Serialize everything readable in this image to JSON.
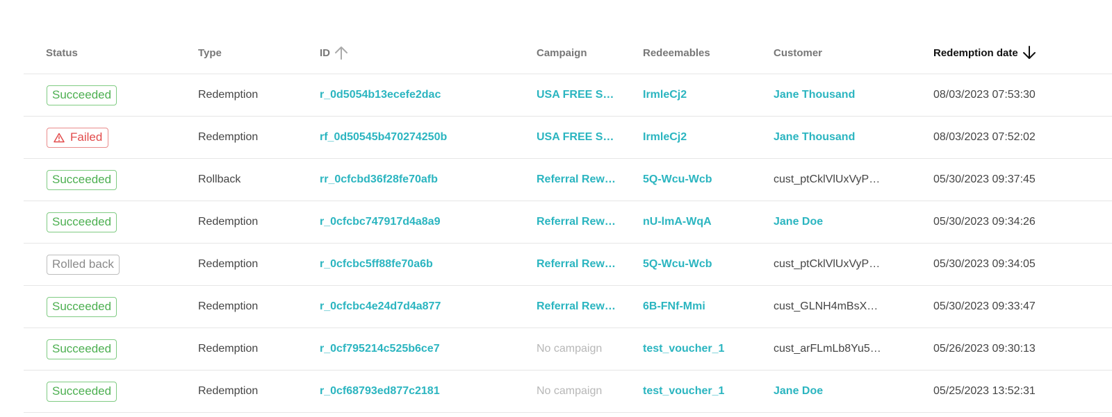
{
  "columns": {
    "status": "Status",
    "type": "Type",
    "id": "ID",
    "campaign": "Campaign",
    "redeemables": "Redeemables",
    "customer": "Customer",
    "redemption_date": "Redemption date"
  },
  "sort": {
    "id_direction": "ascending",
    "date_direction": "descending",
    "active_column": "redemption_date"
  },
  "colors": {
    "link": "#2bb5c0",
    "success": "#4caf50",
    "failed": "#e24b4b",
    "rolled_back": "#8a8a8a"
  },
  "rows": [
    {
      "status": "Succeeded",
      "status_kind": "succeeded",
      "type": "Redemption",
      "id": "r_0d5054b13ecefe2dac",
      "campaign": "USA FREE S…",
      "campaign_kind": "link",
      "redeemable": "IrmleCj2",
      "customer": "Jane Thousand",
      "customer_kind": "link",
      "date": "08/03/2023 07:53:30"
    },
    {
      "status": "Failed",
      "status_kind": "failed",
      "type": "Redemption",
      "id": "rf_0d50545b470274250b",
      "campaign": "USA FREE S…",
      "campaign_kind": "link",
      "redeemable": "IrmleCj2",
      "customer": "Jane Thousand",
      "customer_kind": "link",
      "date": "08/03/2023 07:52:02"
    },
    {
      "status": "Succeeded",
      "status_kind": "succeeded",
      "type": "Rollback",
      "id": "rr_0cfcbd36f28fe70afb",
      "campaign": "Referral Rew…",
      "campaign_kind": "link",
      "redeemable": "5Q-Wcu-Wcb",
      "customer": "cust_ptCklVlUxVyP…",
      "customer_kind": "plain",
      "date": "05/30/2023 09:37:45"
    },
    {
      "status": "Succeeded",
      "status_kind": "succeeded",
      "type": "Redemption",
      "id": "r_0cfcbc747917d4a8a9",
      "campaign": "Referral Rew…",
      "campaign_kind": "link",
      "redeemable": "nU-lmA-WqA",
      "customer": "Jane Doe",
      "customer_kind": "link",
      "date": "05/30/2023 09:34:26"
    },
    {
      "status": "Rolled back",
      "status_kind": "rolled",
      "type": "Redemption",
      "id": "r_0cfcbc5ff88fe70a6b",
      "campaign": "Referral Rew…",
      "campaign_kind": "link",
      "redeemable": "5Q-Wcu-Wcb",
      "customer": "cust_ptCklVlUxVyP…",
      "customer_kind": "plain",
      "date": "05/30/2023 09:34:05"
    },
    {
      "status": "Succeeded",
      "status_kind": "succeeded",
      "type": "Redemption",
      "id": "r_0cfcbc4e24d7d4a877",
      "campaign": "Referral Rew…",
      "campaign_kind": "link",
      "redeemable": "6B-FNf-Mmi",
      "customer": "cust_GLNH4mBsX…",
      "customer_kind": "plain",
      "date": "05/30/2023 09:33:47"
    },
    {
      "status": "Succeeded",
      "status_kind": "succeeded",
      "type": "Redemption",
      "id": "r_0cf795214c525b6ce7",
      "campaign": "No campaign",
      "campaign_kind": "muted",
      "redeemable": "test_voucher_1",
      "customer": "cust_arFLmLb8Yu5…",
      "customer_kind": "plain",
      "date": "05/26/2023 09:30:13"
    },
    {
      "status": "Succeeded",
      "status_kind": "succeeded",
      "type": "Redemption",
      "id": "r_0cf68793ed877c2181",
      "campaign": "No campaign",
      "campaign_kind": "muted",
      "redeemable": "test_voucher_1",
      "customer": "Jane Doe",
      "customer_kind": "link",
      "date": "05/25/2023 13:52:31"
    }
  ]
}
